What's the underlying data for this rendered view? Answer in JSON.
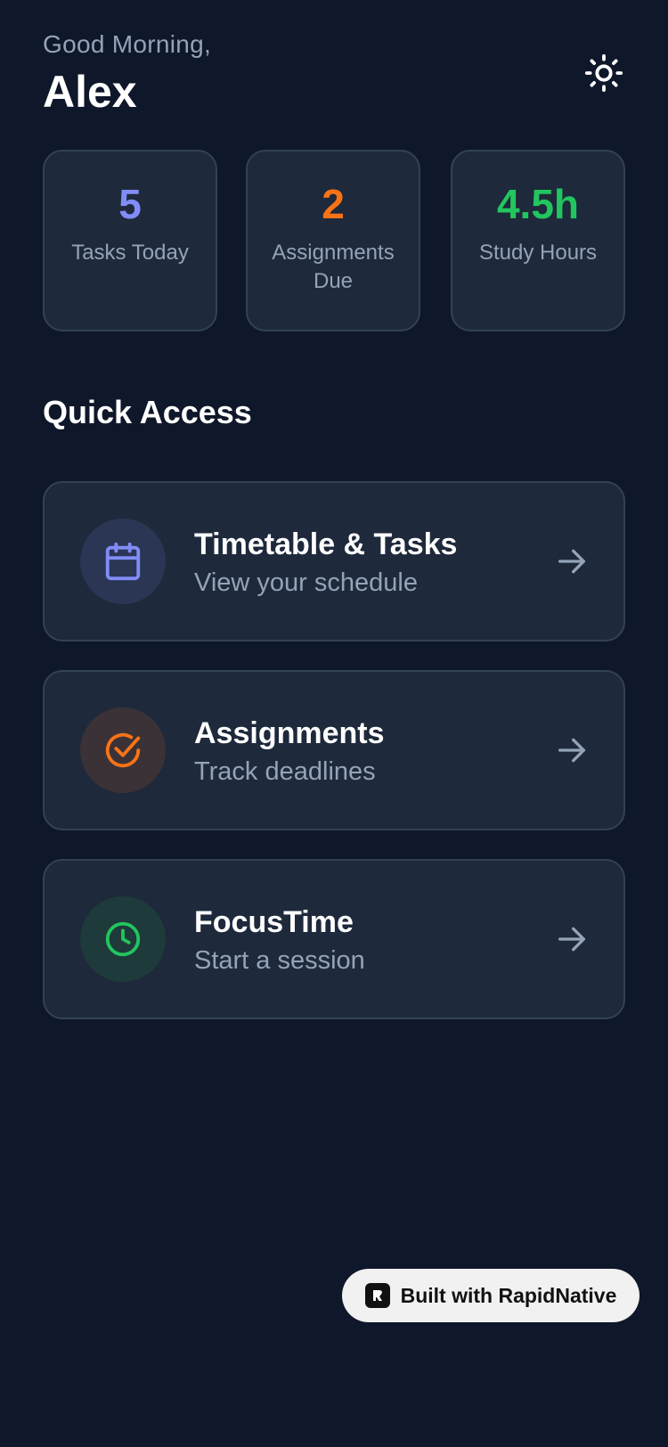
{
  "header": {
    "greeting": "Good Morning,",
    "name": "Alex",
    "theme_toggle_icon": "sun-icon"
  },
  "stats": [
    {
      "value": "5",
      "label": "Tasks Today",
      "color": "#818cf8"
    },
    {
      "value": "2",
      "label": "Assignments Due",
      "color": "#f97316"
    },
    {
      "value": "4.5h",
      "label": "Study Hours",
      "color": "#22c55e"
    }
  ],
  "quick_access": {
    "title": "Quick Access",
    "items": [
      {
        "title": "Timetable & Tasks",
        "subtitle": "View your schedule",
        "icon": "calendar-icon",
        "color": "#818cf8"
      },
      {
        "title": "Assignments",
        "subtitle": "Track deadlines",
        "icon": "check-circle-icon",
        "color": "#f97316"
      },
      {
        "title": "FocusTime",
        "subtitle": "Start a session",
        "icon": "clock-icon",
        "color": "#22c55e"
      }
    ]
  },
  "badge": {
    "label": "Built with RapidNative",
    "icon": "rapidnative-logo-icon"
  }
}
